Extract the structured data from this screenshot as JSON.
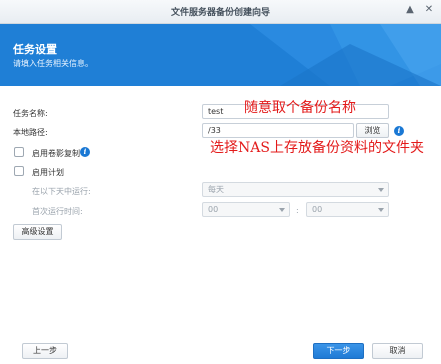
{
  "window": {
    "title": "文件服务器备份创建向导",
    "pin_icon": "pin-icon",
    "close_icon": "close-icon"
  },
  "header": {
    "title": "任务设置",
    "subtitle": "请填入任务相关信息。",
    "accent_color": "#1f7fd6"
  },
  "form": {
    "task_name_label": "任务名称:",
    "task_name_value": "test",
    "local_path_label": "本地路径:",
    "local_path_value": "/33",
    "browse_label": "浏览",
    "snapshot_copy_label": "启用卷影复制",
    "snapshot_copy_checked": false,
    "enable_schedule_label": "启用计划",
    "enable_schedule_checked": false,
    "run_days_label": "在以下天中运行:",
    "run_days_value": "每天",
    "first_run_label": "首次运行时间:",
    "first_run_hour": "00",
    "time_separator": ":",
    "first_run_minute": "00",
    "advanced_label": "高级设置"
  },
  "annotations": {
    "name_note": "随意取个备份名称",
    "path_note": "选择NAS上存放备份资料的文件夹",
    "color": "#e31a1a"
  },
  "footer": {
    "prev_label": "上一步",
    "next_label": "下一步",
    "cancel_label": "取消"
  }
}
